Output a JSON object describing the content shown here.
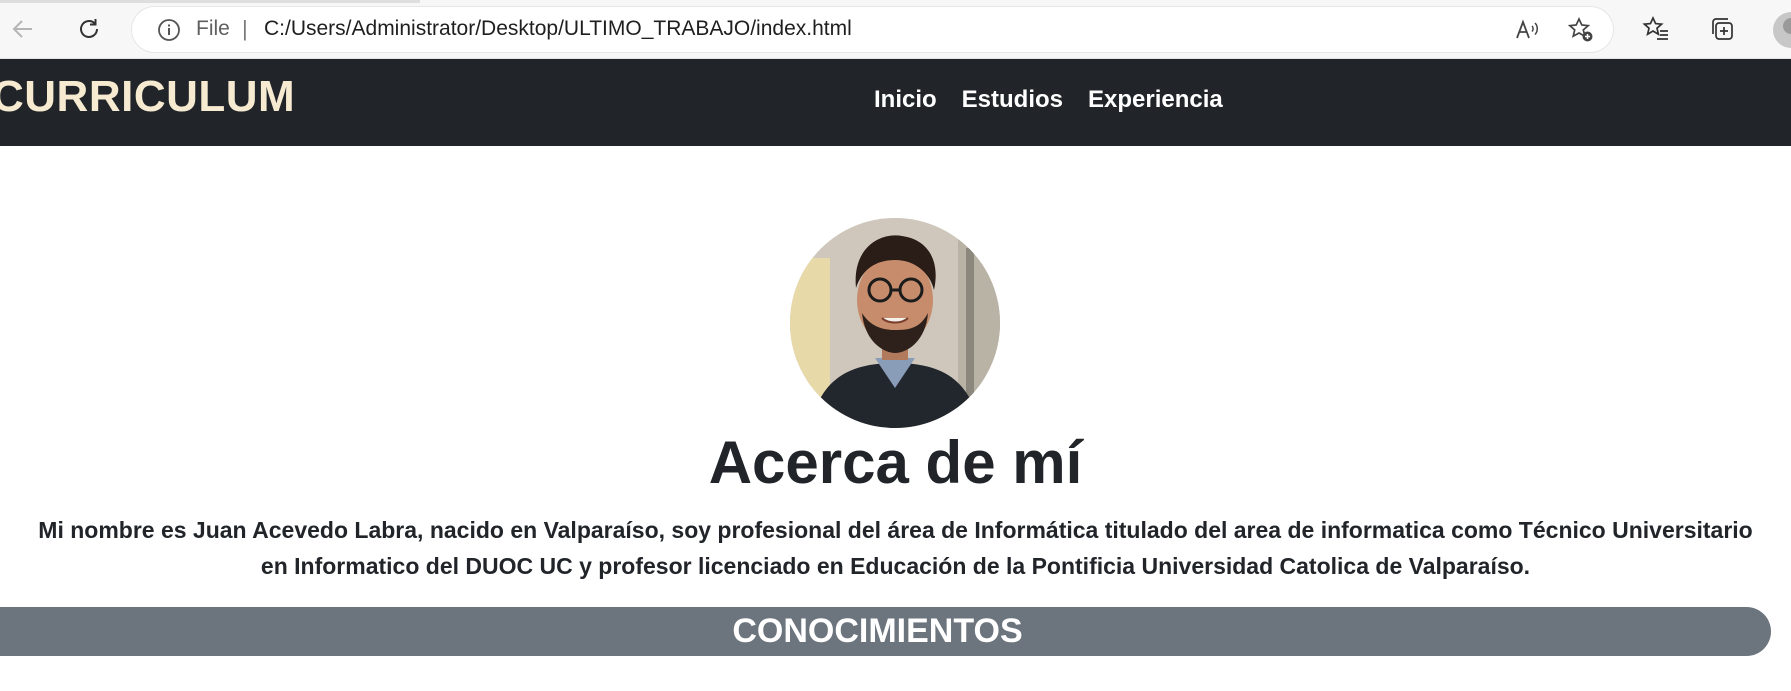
{
  "browser": {
    "scheme_label": "File",
    "separator": "|",
    "url": "C:/Users/Administrator/Desktop/ULTIMO_TRABAJO/index.html",
    "icons": [
      "back-arrow-icon",
      "refresh-icon",
      "info-icon",
      "read-aloud-icon",
      "add-favorite-icon",
      "favorites-icon",
      "collections-icon",
      "profile-avatar"
    ]
  },
  "site": {
    "brand": "CURRICULUM",
    "nav": [
      "Inicio",
      "Estudios",
      "Experiencia"
    ],
    "colors": {
      "navbar": "#212529",
      "brand": "#f6ead0",
      "section_band": "#6c757d"
    }
  },
  "about": {
    "title": "Acerca de mí",
    "text": "Mi nombre es Juan Acevedo Labra, nacido en Valparaíso, soy profesional del área de Informática titulado del area de informatica como Técnico Universitario en Informatico del DUOC UC y profesor licenciado en Educación de la Pontificia Universidad Catolica de Valparaíso."
  },
  "section": {
    "title": "CONOCIMIENTOS"
  }
}
